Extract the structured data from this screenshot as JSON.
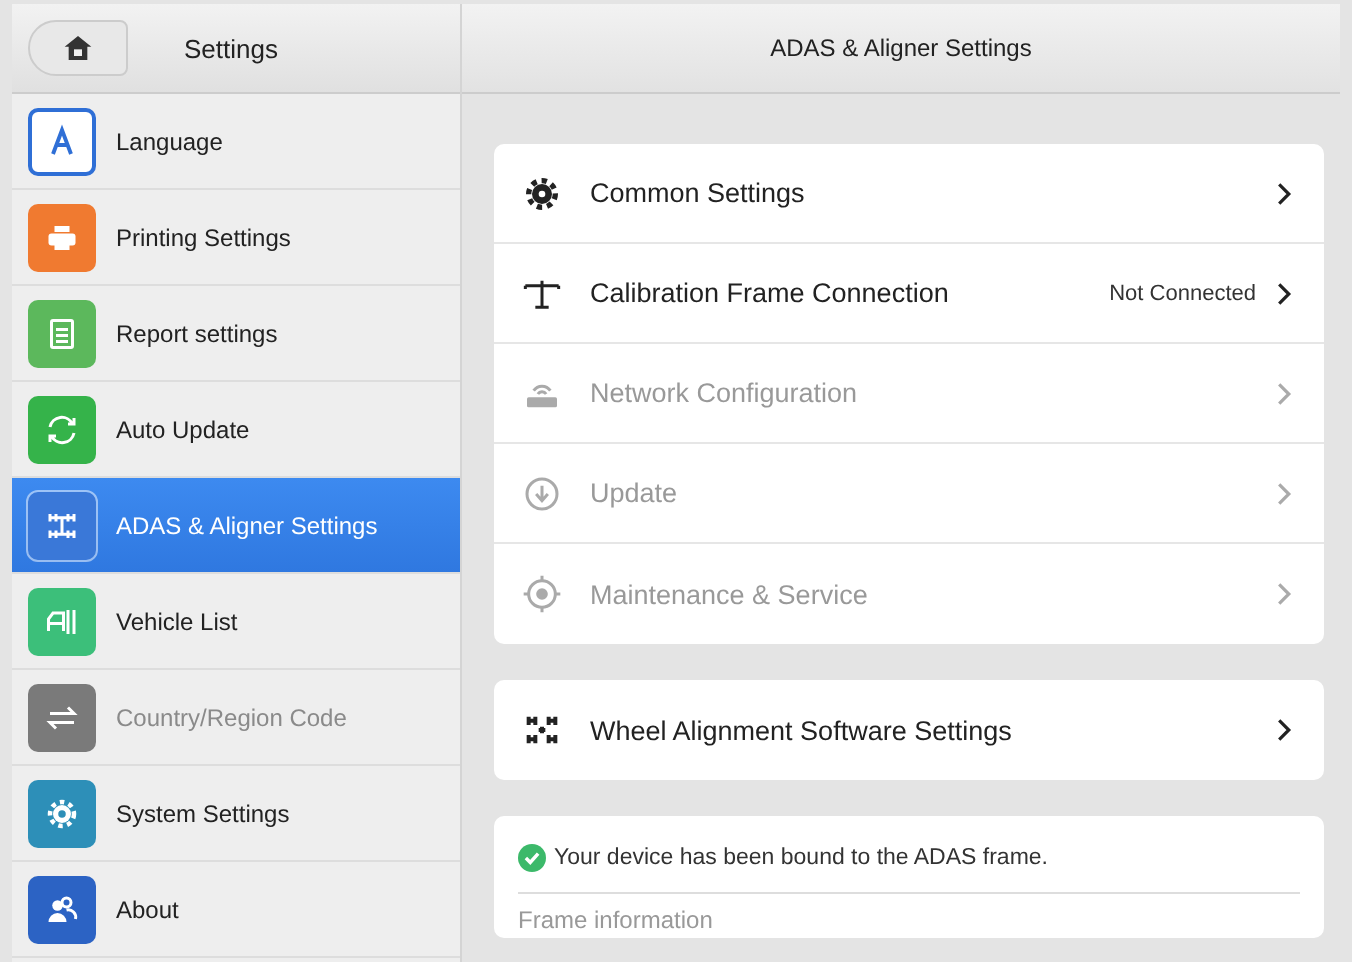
{
  "sidebar": {
    "title": "Settings",
    "items": [
      {
        "label": "Language",
        "kind": "language",
        "color": "#2f6fd6",
        "selected": false,
        "disabled": false
      },
      {
        "label": "Printing Settings",
        "kind": "printer",
        "color": "#f07a30",
        "selected": false,
        "disabled": false
      },
      {
        "label": "Report settings",
        "kind": "report",
        "color": "#5cb85c",
        "selected": false,
        "disabled": false
      },
      {
        "label": "Auto Update",
        "kind": "update",
        "color": "#35b34a",
        "selected": false,
        "disabled": false
      },
      {
        "label": "ADAS & Aligner Settings",
        "kind": "adas",
        "color": "#3a78d8",
        "selected": true,
        "disabled": false
      },
      {
        "label": "Vehicle List",
        "kind": "vehicle",
        "color": "#3cbf7a",
        "selected": false,
        "disabled": false
      },
      {
        "label": "Country/Region Code",
        "kind": "swap",
        "color": "#7a7a7a",
        "selected": false,
        "disabled": true
      },
      {
        "label": "System Settings",
        "kind": "gear",
        "color": "#2d8fb8",
        "selected": false,
        "disabled": false
      },
      {
        "label": "About",
        "kind": "people",
        "color": "#2c63c4",
        "selected": false,
        "disabled": false
      }
    ]
  },
  "content": {
    "title": "ADAS & Aligner Settings",
    "settings": [
      {
        "label": "Common Settings",
        "kind": "gear",
        "disabled": false
      },
      {
        "label": "Calibration Frame Connection",
        "kind": "frame",
        "value": "Not Connected",
        "disabled": false
      },
      {
        "label": "Network Configuration",
        "kind": "router",
        "disabled": true
      },
      {
        "label": "Update",
        "kind": "download",
        "disabled": true
      },
      {
        "label": "Maintenance & Service",
        "kind": "target",
        "disabled": true
      }
    ],
    "aligner": {
      "label": "Wheel Alignment Software Settings",
      "kind": "adas",
      "disabled": false
    },
    "status": {
      "message": "Your device has been bound to the ADAS frame.",
      "ok": true
    },
    "section_title": "Frame information"
  }
}
